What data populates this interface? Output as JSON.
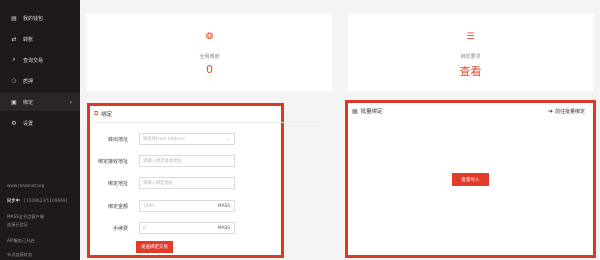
{
  "sidebar": {
    "items": [
      {
        "icon": "▤",
        "label": "我的钱包"
      },
      {
        "icon": "⇄",
        "label": "转账"
      },
      {
        "icon": "⌕",
        "label": "查询交易"
      },
      {
        "icon": "⚆",
        "label": "质押"
      },
      {
        "icon": "▣",
        "label": "绑定",
        "chevron": "›"
      },
      {
        "icon": "⚙",
        "label": "设置"
      }
    ],
    "website": "www.massnet.org",
    "sync_status": "同步中",
    "sync_progress": "[1109623/1109669]",
    "foot_lines": [
      "MASS全节点客户端",
      "连接已验证",
      "API服务已开启",
      "节点连接状态"
    ]
  },
  "cards": [
    {
      "icon": "❂",
      "label": "全网难度",
      "value": "0"
    },
    {
      "icon": "☰",
      "label": "绑定要求",
      "value": "查看"
    }
  ],
  "bind_panel": {
    "title": "绑定",
    "fields": [
      {
        "label": "转出地址",
        "placeholder": "请选择From Address",
        "dropdown": true
      },
      {
        "label": "绑定接收地址",
        "placeholder": "请输入绑定接收地址"
      },
      {
        "label": "绑定地址",
        "placeholder": "请输入绑定地址"
      },
      {
        "label": "绑定金额",
        "placeholder": "1000",
        "unit": "MASS"
      },
      {
        "label": "手续费",
        "placeholder": "0",
        "unit": "MASS"
      }
    ],
    "submit_label": "发送绑定交易"
  },
  "batch_panel": {
    "title": "批量绑定",
    "goto_label": "前往批量绑定",
    "import_label": "批量导入"
  },
  "colors": {
    "accent": "#e84a2a",
    "sidebar_bg": "#1f1a1a",
    "frame": "#d83a28"
  }
}
